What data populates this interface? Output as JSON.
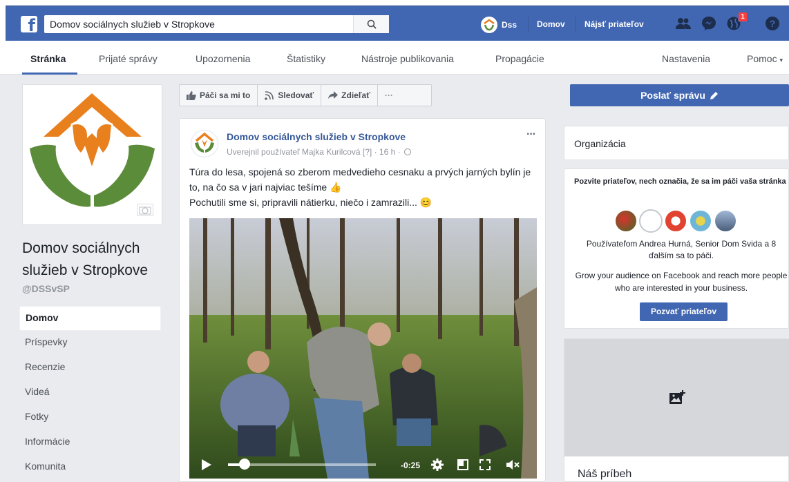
{
  "topbar": {
    "search_value": "Domov sociálnych služieb v Stropkove",
    "user_name": "Dss",
    "home_label": "Domov",
    "find_friends_label": "Nájsť priateľov",
    "notification_count": "1",
    "colors": {
      "blue": "#4267b2",
      "red_badge": "#fa3e3e"
    }
  },
  "tabs": [
    {
      "label": "Stránka"
    },
    {
      "label": "Prijaté správy"
    },
    {
      "label": "Upozornenia"
    },
    {
      "label": "Štatistiky"
    },
    {
      "label": "Nástroje publikovania"
    },
    {
      "label": "Propagácie"
    },
    {
      "label": "Nastavenia"
    },
    {
      "label": "Pomoc"
    }
  ],
  "sidebar": {
    "page_name": "Domov sociálnych služieb v Stropkove",
    "handle": "@DSSvSP",
    "items": [
      {
        "label": "Domov"
      },
      {
        "label": "Príspevky"
      },
      {
        "label": "Recenzie"
      },
      {
        "label": "Videá"
      },
      {
        "label": "Fotky"
      },
      {
        "label": "Informácie"
      },
      {
        "label": "Komunita"
      }
    ]
  },
  "actions": {
    "like": "Páči sa mi to",
    "follow": "Sledovať",
    "share": "Zdieľať",
    "more": "···"
  },
  "post": {
    "author": "Domov sociálnych služieb v Stropkove",
    "meta": "Uverejnil používateľ Majka Kurilcová [?] · 16 h ·",
    "more": "···",
    "text_line1": "Túra do lesa, spojená so zberom medvedieho cesnaku a prvých jarných bylín je to, na čo sa v jari najviac tešíme 👍",
    "text_line2": "Pochutili sme si, pripravili nátierku, niečo i zamrazili... 😊",
    "video_time": "-0:25",
    "video_progress": 0.11
  },
  "right": {
    "send_message": "Poslať správu",
    "org_label": "Organizácia",
    "invite_title": "Pozvite priateľov, nech označia, že sa im páči vaša stránka",
    "invite_liked": "Používateľom Andrea Hurná, Senior Dom Svida a 8 ďalším sa to páči.",
    "invite_grow": "Grow your audience on Facebook and reach more people who are interested in your business.",
    "invite_button": "Pozvať priateľov",
    "story_title": "Náš príbeh"
  }
}
